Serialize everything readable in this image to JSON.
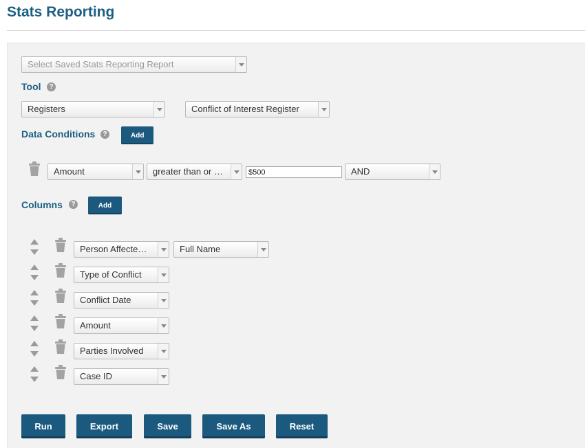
{
  "page": {
    "title": "Stats Reporting"
  },
  "saved_report": {
    "placeholder": "Select Saved Stats Reporting Report"
  },
  "tool": {
    "label": "Tool",
    "help": "?",
    "type_value": "Registers",
    "register_value": "Conflict of Interest Register"
  },
  "data_conditions": {
    "label": "Data Conditions",
    "help": "?",
    "add_label": "Add",
    "rows": [
      {
        "field": "Amount",
        "operator": "greater than or …",
        "value": "$500",
        "logic": "AND"
      }
    ]
  },
  "columns": {
    "label": "Columns",
    "help": "?",
    "add_label": "Add",
    "rows": [
      {
        "field": "Person Affecte…",
        "subfield": "Full Name"
      },
      {
        "field": "Type of Conflict"
      },
      {
        "field": "Conflict Date"
      },
      {
        "field": "Amount"
      },
      {
        "field": "Parties Involved"
      },
      {
        "field": "Case ID"
      }
    ]
  },
  "actions": {
    "run": "Run",
    "export": "Export",
    "save": "Save",
    "save_as": "Save As",
    "reset": "Reset"
  },
  "colors": {
    "accent": "#1d5f82",
    "button": "#1b5a7e",
    "panel": "#f2f2f2"
  },
  "icons": [
    "help-icon",
    "trash-icon",
    "move-up-icon",
    "move-down-icon",
    "dropdown-arrow-icon"
  ]
}
